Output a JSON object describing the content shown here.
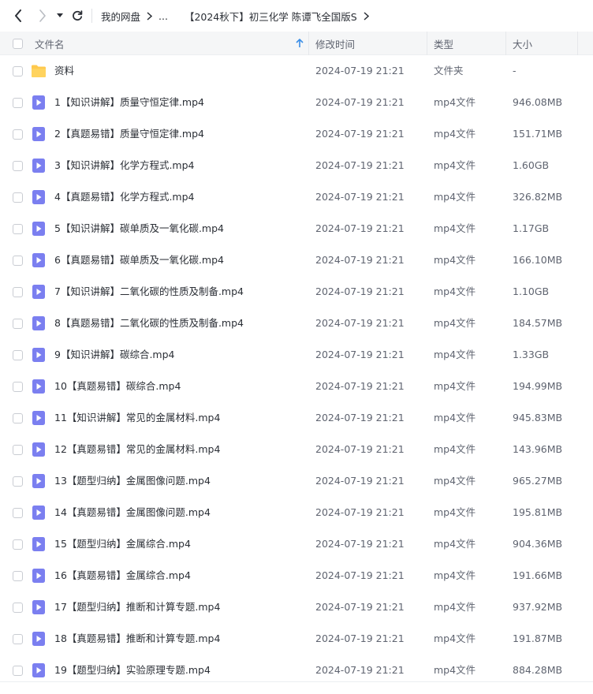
{
  "breadcrumb": {
    "root": "我的网盘",
    "ellipsis": "...",
    "current": "【2024秋下】初三化学 陈谭飞全国版S"
  },
  "header": {
    "name": "文件名",
    "modified": "修改时间",
    "type": "类型",
    "size": "大小"
  },
  "colors": {
    "folder": "#ffc94d",
    "video": "#7b7ff0",
    "sort_arrow": "#3a8ee6",
    "header_bg": "#f5f6f7"
  },
  "files": [
    {
      "name": "资料",
      "date": "2024-07-19 21:21",
      "type": "文件夹",
      "size": "-",
      "icon": "folder-icon"
    },
    {
      "name": "1【知识讲解】质量守恒定律.mp4",
      "date": "2024-07-19 21:21",
      "type": "mp4文件",
      "size": "946.08MB",
      "icon": "video-icon"
    },
    {
      "name": "2【真题易错】质量守恒定律.mp4",
      "date": "2024-07-19 21:21",
      "type": "mp4文件",
      "size": "151.71MB",
      "icon": "video-icon"
    },
    {
      "name": "3【知识讲解】化学方程式.mp4",
      "date": "2024-07-19 21:21",
      "type": "mp4文件",
      "size": "1.60GB",
      "icon": "video-icon"
    },
    {
      "name": "4【真题易错】化学方程式.mp4",
      "date": "2024-07-19 21:21",
      "type": "mp4文件",
      "size": "326.82MB",
      "icon": "video-icon"
    },
    {
      "name": "5【知识讲解】碳单质及一氧化碳.mp4",
      "date": "2024-07-19 21:21",
      "type": "mp4文件",
      "size": "1.17GB",
      "icon": "video-icon"
    },
    {
      "name": "6【真题易错】碳单质及一氧化碳.mp4",
      "date": "2024-07-19 21:21",
      "type": "mp4文件",
      "size": "166.10MB",
      "icon": "video-icon"
    },
    {
      "name": "7【知识讲解】二氧化碳的性质及制备.mp4",
      "date": "2024-07-19 21:21",
      "type": "mp4文件",
      "size": "1.10GB",
      "icon": "video-icon"
    },
    {
      "name": "8【真题易错】二氧化碳的性质及制备.mp4",
      "date": "2024-07-19 21:21",
      "type": "mp4文件",
      "size": "184.57MB",
      "icon": "video-icon"
    },
    {
      "name": "9【知识讲解】碳综合.mp4",
      "date": "2024-07-19 21:21",
      "type": "mp4文件",
      "size": "1.33GB",
      "icon": "video-icon"
    },
    {
      "name": "10【真题易错】碳综合.mp4",
      "date": "2024-07-19 21:21",
      "type": "mp4文件",
      "size": "194.99MB",
      "icon": "video-icon"
    },
    {
      "name": "11【知识讲解】常见的金属材料.mp4",
      "date": "2024-07-19 21:21",
      "type": "mp4文件",
      "size": "945.83MB",
      "icon": "video-icon"
    },
    {
      "name": "12【真题易错】常见的金属材料.mp4",
      "date": "2024-07-19 21:21",
      "type": "mp4文件",
      "size": "143.96MB",
      "icon": "video-icon"
    },
    {
      "name": "13【题型归纳】金属图像问题.mp4",
      "date": "2024-07-19 21:21",
      "type": "mp4文件",
      "size": "965.27MB",
      "icon": "video-icon"
    },
    {
      "name": "14【真题易错】金属图像问题.mp4",
      "date": "2024-07-19 21:21",
      "type": "mp4文件",
      "size": "195.81MB",
      "icon": "video-icon"
    },
    {
      "name": "15【题型归纳】金属综合.mp4",
      "date": "2024-07-19 21:21",
      "type": "mp4文件",
      "size": "904.36MB",
      "icon": "video-icon"
    },
    {
      "name": "16【真题易错】金属综合.mp4",
      "date": "2024-07-19 21:21",
      "type": "mp4文件",
      "size": "191.66MB",
      "icon": "video-icon"
    },
    {
      "name": "17【题型归纳】推断和计算专题.mp4",
      "date": "2024-07-19 21:21",
      "type": "mp4文件",
      "size": "937.92MB",
      "icon": "video-icon"
    },
    {
      "name": "18【真题易错】推断和计算专题.mp4",
      "date": "2024-07-19 21:21",
      "type": "mp4文件",
      "size": "191.87MB",
      "icon": "video-icon"
    },
    {
      "name": "19【题型归纳】实验原理专题.mp4",
      "date": "2024-07-19 21:21",
      "type": "mp4文件",
      "size": "884.28MB",
      "icon": "video-icon"
    }
  ]
}
